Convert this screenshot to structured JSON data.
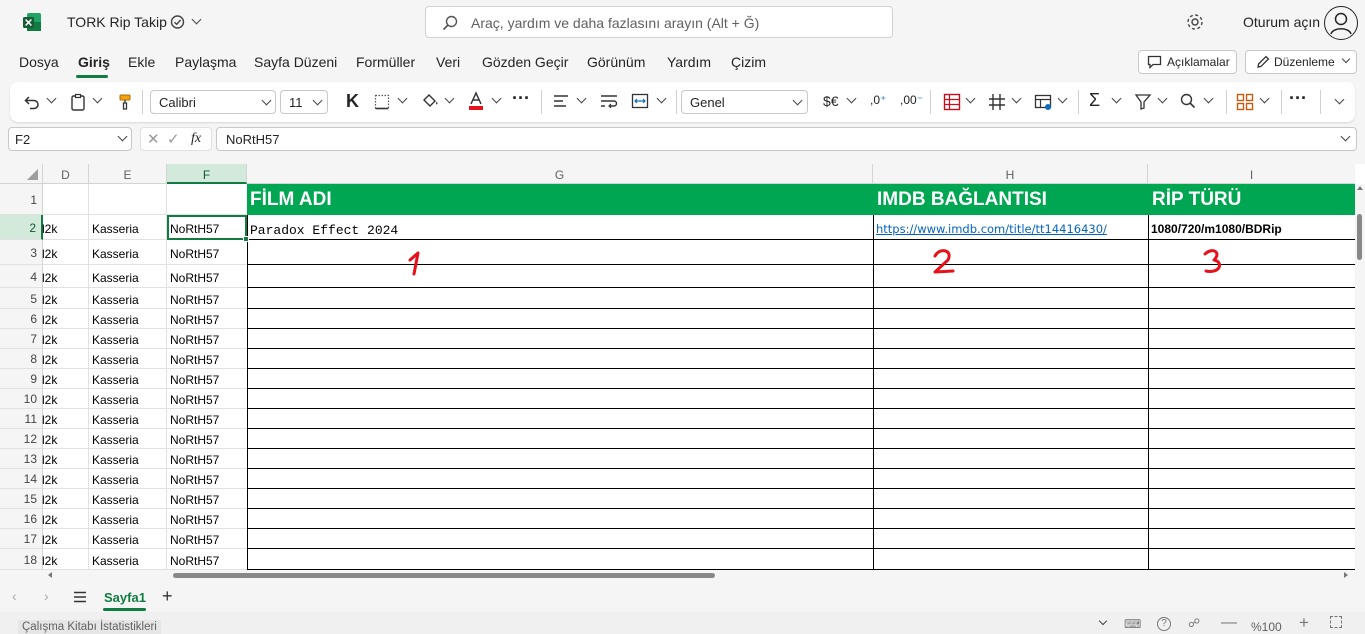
{
  "app": {
    "title": "TORK Rip Takip",
    "search_placeholder": "Araç, yardım ve daha fazlasını arayın (Alt + Ğ)",
    "sign_in": "Oturum açın"
  },
  "menu": {
    "items": [
      "Dosya",
      "Giriş",
      "Ekle",
      "Paylaşma",
      "Sayfa Düzeni",
      "Formüller",
      "Veri",
      "Gözden Geçir",
      "Görünüm",
      "Yardım",
      "Çizim"
    ],
    "active": "Giriş",
    "comments_label": "Açıklamalar",
    "editing_label": "Düzenleme"
  },
  "ribbon": {
    "font_name": "Calibri",
    "font_size": "11",
    "bold_label": "K",
    "number_format": "Genel",
    "currency_label": "$€"
  },
  "formula_bar": {
    "name_box": "F2",
    "fx_label": "fx",
    "formula": "NoRtH57"
  },
  "grid": {
    "columns": [
      "D",
      "E",
      "F",
      "G",
      "H",
      "I"
    ],
    "selected_column": "F",
    "selected_row": "2",
    "header_row": {
      "G": "FİLM ADI",
      "H": "IMDB BAĞLANTISI",
      "I": "RİP TÜRÜ"
    },
    "row2": {
      "D": "l2k",
      "E": "Kasseria",
      "F": "NoRtH57",
      "G": "Paradox Effect 2024",
      "H": "https://www.imdb.com/title/tt14416430/",
      "I": "1080/720/m1080/BDRip"
    },
    "repeat_rows": {
      "D": "l2k",
      "E": "Kasseria",
      "F": "NoRtH57"
    },
    "row_numbers": [
      "1",
      "2",
      "3",
      "4",
      "5",
      "6",
      "7",
      "8",
      "9",
      "10",
      "11",
      "12",
      "13",
      "14",
      "15",
      "16",
      "17",
      "18"
    ],
    "annotations": [
      "1",
      "2",
      "3"
    ],
    "brand_color": "#00a651",
    "accent_color": "#107c41",
    "annotation_color": "#e8101a"
  },
  "sheets": {
    "tabs": [
      "Sayfa1"
    ],
    "active": "Sayfa1"
  },
  "status": {
    "left": "Çalışma Kitabı İstatistikleri",
    "zoom": "%100"
  }
}
